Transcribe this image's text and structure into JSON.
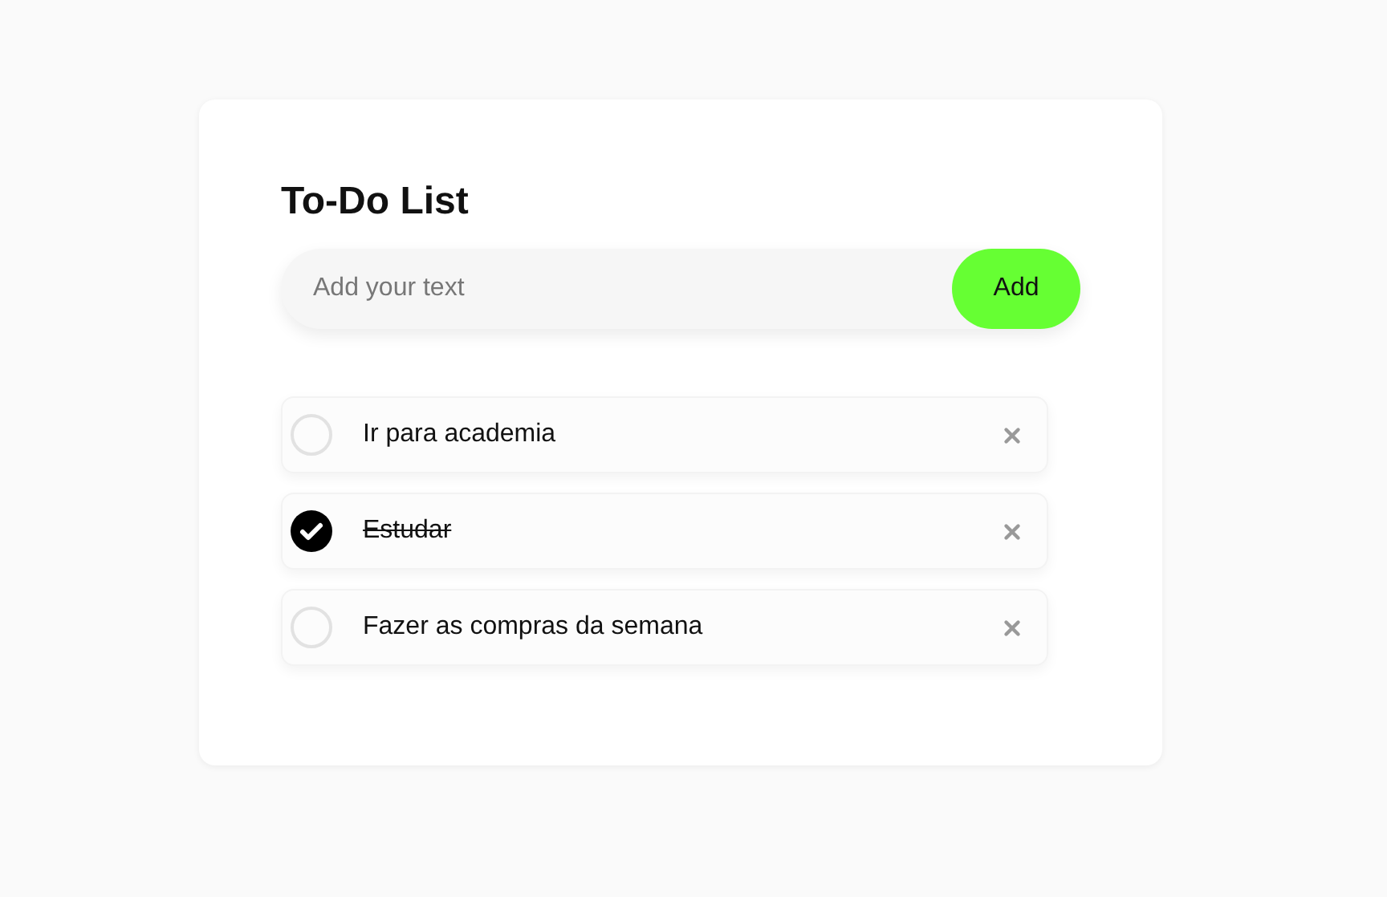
{
  "title": "To-Do List",
  "input": {
    "placeholder": "Add your text"
  },
  "add_button": "Add",
  "tasks": [
    {
      "text": "Ir para academia",
      "checked": false
    },
    {
      "text": "Estudar",
      "checked": true
    },
    {
      "text": "Fazer as compras da semana",
      "checked": false
    }
  ]
}
